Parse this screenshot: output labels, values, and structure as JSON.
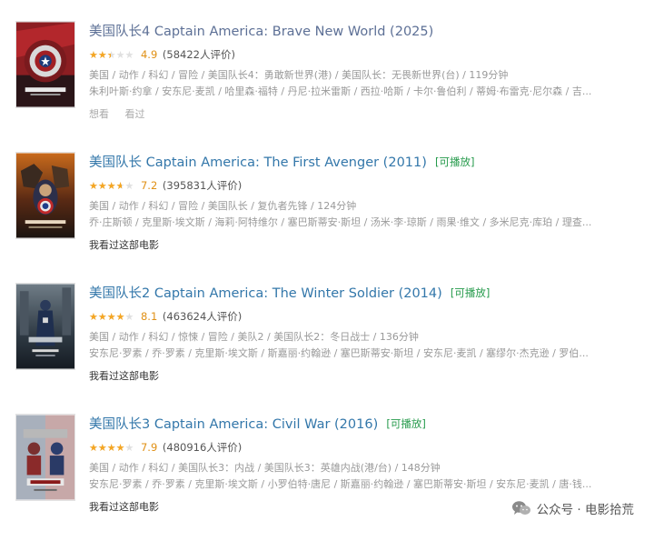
{
  "movies": [
    {
      "title": "美国队长4 Captain America: Brave New World (2025)",
      "playable": "",
      "rating": 4.9,
      "rating_fraction": 0.49,
      "score_text": "4.9",
      "count_text": "(58422人评价)",
      "meta": "美国 / 动作 / 科幻 / 冒险 / 美国队长4：勇敢新世界(港) / 美国队长：无畏新世界(台) / 119分钟",
      "cast": "朱利叶斯·约拿 / 安东尼·麦凯 / 哈里森·福特 / 丹尼·拉米雷斯 / 西拉·哈斯 / 卡尔·鲁伯利 / 蒂姆·布雷克·尼尔森 / 吉...",
      "actions": [
        "想看",
        "看过"
      ],
      "poster_icon": "captain-america-shield-poster"
    },
    {
      "title": "美国队长 Captain America: The First Avenger (2011)",
      "playable": "[可播放]",
      "rating": 7.2,
      "rating_fraction": 0.72,
      "score_text": "7.2",
      "count_text": "(395831人评价)",
      "meta": "美国 / 动作 / 科幻 / 冒险 / 美国队长 / 复仇者先锋 / 124分钟",
      "cast": "乔·庄斯顿 / 克里斯·埃文斯 / 海莉·阿特维尔 / 塞巴斯蒂安·斯坦 / 汤米·李·琼斯 / 雨果·维文 / 多米尼克·库珀 / 理查...",
      "actions": [
        "我看过这部电影"
      ],
      "poster_icon": "first-avenger-poster"
    },
    {
      "title": "美国队长2 Captain America: The Winter Soldier (2014)",
      "playable": "[可播放]",
      "rating": 8.1,
      "rating_fraction": 0.81,
      "score_text": "8.1",
      "count_text": "(463624人评价)",
      "meta": "美国 / 动作 / 科幻 / 惊悚 / 冒险 / 美队2 / 美国队长2：冬日战士 / 136分钟",
      "cast": "安东尼·罗素 / 乔·罗素 / 克里斯·埃文斯 / 斯嘉丽·约翰逊 / 塞巴斯蒂安·斯坦 / 安东尼·麦凯 / 塞缪尔·杰克逊 / 罗伯...",
      "actions": [
        "我看过这部电影"
      ],
      "poster_icon": "winter-soldier-poster"
    },
    {
      "title": "美国队长3 Captain America: Civil War (2016)",
      "playable": "[可播放]",
      "rating": 7.9,
      "rating_fraction": 0.79,
      "score_text": "7.9",
      "count_text": "(480916人评价)",
      "meta": "美国 / 动作 / 科幻 / 美国队长3：内战 / 美国队长3：英雄内战(港/台) / 148分钟",
      "cast": "安东尼·罗素 / 乔·罗素 / 克里斯·埃文斯 / 小罗伯特·唐尼 / 斯嘉丽·约翰逊 / 塞巴斯蒂安·斯坦 / 安东尼·麦凯 / 唐·钱...",
      "actions": [
        "我看过这部电影"
      ],
      "poster_icon": "civil-war-poster"
    }
  ],
  "watermark": {
    "text": "公众号 · 电影拾荒",
    "icon": "wechat-icon"
  },
  "colors": {
    "link": "#3377aa",
    "playable": "#259a4b",
    "star": "#f5a623",
    "score": "#e09015",
    "meta": "#999999"
  }
}
